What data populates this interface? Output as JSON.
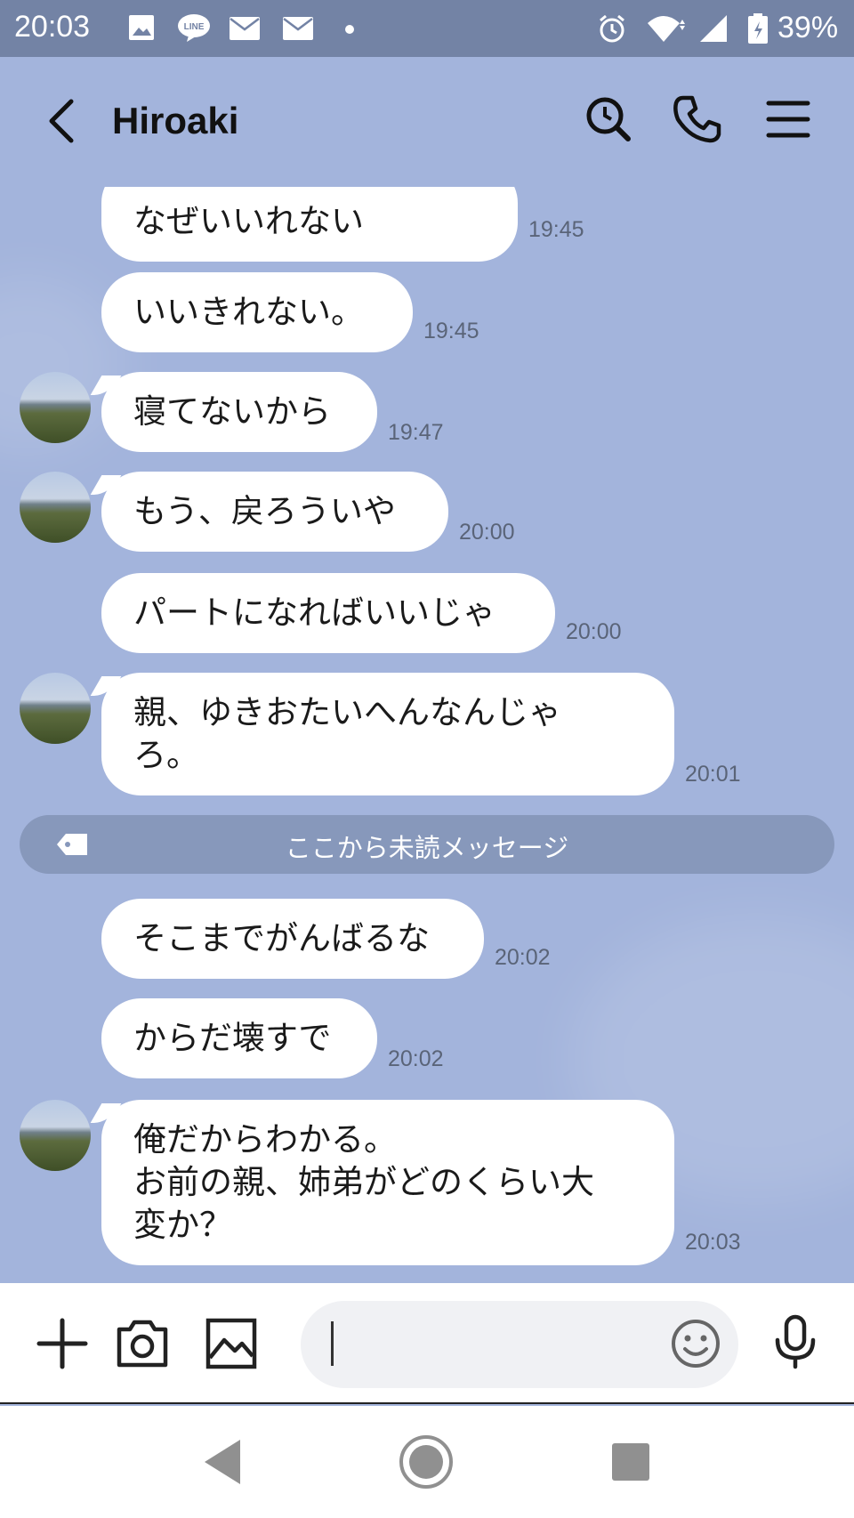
{
  "status_bar": {
    "time": "20:03",
    "battery": "39%",
    "notification_icons": [
      "image-icon",
      "line-icon",
      "mail-icon",
      "mail-icon"
    ],
    "system_icons": [
      "alarm-icon",
      "wifi-icon",
      "signal-icon",
      "battery-icon"
    ]
  },
  "header": {
    "title": "Hiroaki",
    "icons": [
      "back-icon",
      "search-icon",
      "phone-icon",
      "menu-icon"
    ]
  },
  "messages": [
    {
      "text": "なぜいいれない",
      "time": "19:45"
    },
    {
      "text": "いいきれない。",
      "time": "19:45"
    },
    {
      "text": "寝てないから",
      "time": "19:47"
    },
    {
      "text": "もう、戻ろういや",
      "time": "20:00"
    },
    {
      "text": "パートになればいいじゃ",
      "time": "20:00"
    },
    {
      "text": "親、ゆきおたいへんなんじゃ\nろ。",
      "time": "20:01"
    },
    {
      "text": "そこまでがんばるな",
      "time": "20:02"
    },
    {
      "text": "からだ壊すで",
      "time": "20:02"
    },
    {
      "text": "俺だからわかる。\nお前の親、姉弟がどのくらい大\n変か？",
      "time": "20:03"
    }
  ],
  "unread_divider": {
    "label": "ここから未読メッセージ"
  },
  "input_bar": {
    "icons": [
      "plus-icon",
      "camera-icon",
      "image-icon",
      "emoji-icon",
      "microphone-icon"
    ],
    "value": ""
  },
  "nav_bar": {
    "icons": [
      "back-nav-icon",
      "home-icon",
      "recents-icon"
    ]
  }
}
